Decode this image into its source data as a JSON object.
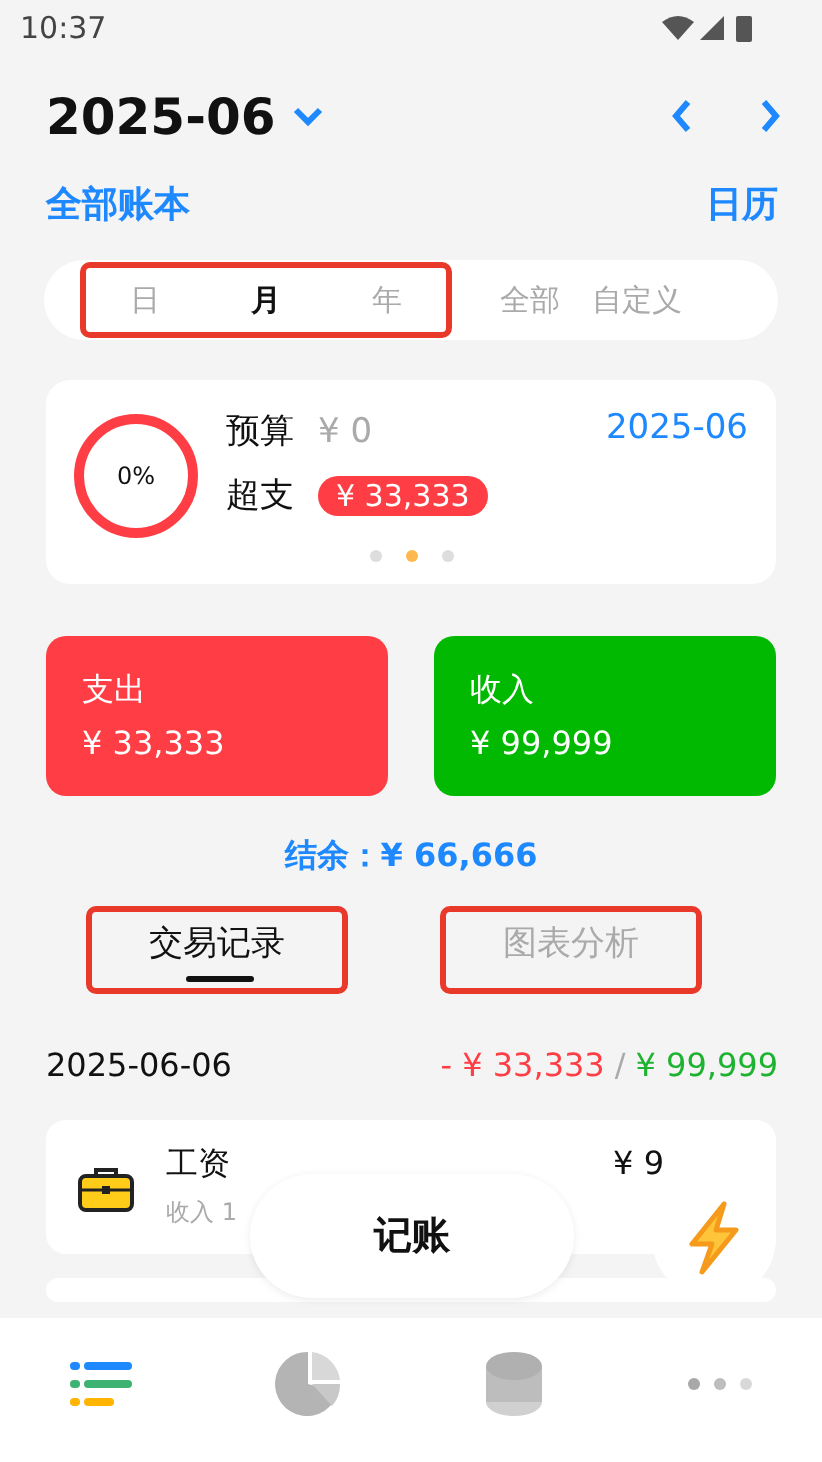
{
  "status_bar": {
    "time": "10:37"
  },
  "header": {
    "month": "2025-06",
    "book": "全部账本",
    "calendar": "日历"
  },
  "ranges": {
    "framed": [
      {
        "label": "日",
        "selected": false
      },
      {
        "label": "月",
        "selected": true
      },
      {
        "label": "年",
        "selected": false
      }
    ],
    "others": [
      {
        "label": "全部",
        "selected": false
      },
      {
        "label": "自定义",
        "selected": false
      }
    ]
  },
  "budget": {
    "percent": "0%",
    "budget_label": "预算",
    "budget_value": "¥ 0",
    "date": "2025-06",
    "over_label": "超支",
    "over_value": "¥ 33,333",
    "pages": [
      {
        "selected": false
      },
      {
        "selected": true
      },
      {
        "selected": false
      }
    ]
  },
  "totals": [
    {
      "label": "支出",
      "value": "¥ 33,333",
      "color": "#ff3d44"
    },
    {
      "label": "收入",
      "value": "¥ 99,999",
      "color": "#02b902"
    }
  ],
  "balance": "结余：¥ 66,666",
  "tabs": [
    {
      "label": "交易记录",
      "selected": true
    },
    {
      "label": "图表分析",
      "selected": false
    }
  ],
  "day": {
    "date": "2025-06-06",
    "expense": "- ¥ 33,333",
    "separator": "/",
    "income": "¥ 99,999"
  },
  "transactions": [
    {
      "title": "工资",
      "subtitle": "收入 1",
      "amount": "¥ 9"
    }
  ],
  "add_button": "记账",
  "nav": [
    {
      "kind": "list",
      "selected": true
    },
    {
      "kind": "pie",
      "selected": false
    },
    {
      "kind": "coins",
      "selected": false
    },
    {
      "kind": "more",
      "selected": false
    }
  ]
}
